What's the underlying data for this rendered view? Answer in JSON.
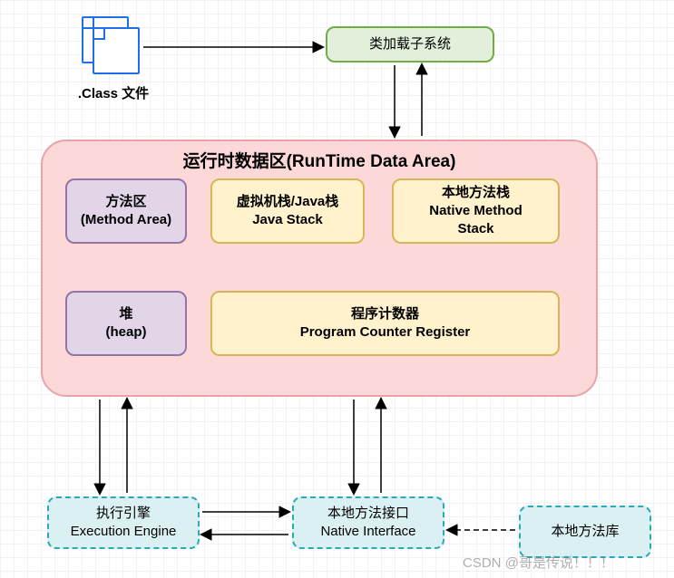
{
  "classfile": {
    "label": ".Class 文件"
  },
  "classloader": {
    "label": "类加载子系统"
  },
  "runtime": {
    "title": "运行时数据区(RunTime Data Area)",
    "method_area": {
      "l1": "方法区",
      "l2": "(Method Area)"
    },
    "java_stack": {
      "l1": "虚拟机栈/Java栈",
      "l2": "Java Stack"
    },
    "native_stack": {
      "l1": "本地方法栈",
      "l2": "Native Method",
      "l3": "Stack"
    },
    "heap": {
      "l1": "堆",
      "l2": "(heap)"
    },
    "pc": {
      "l1": "程序计数器",
      "l2": "Program Counter Register"
    }
  },
  "exec_engine": {
    "l1": "执行引擎",
    "l2": "Execution Engine"
  },
  "native_interface": {
    "l1": "本地方法接口",
    "l2": "Native Interface"
  },
  "native_lib": {
    "label": "本地方法库"
  },
  "watermark": "CSDN @哥是传说！！！"
}
